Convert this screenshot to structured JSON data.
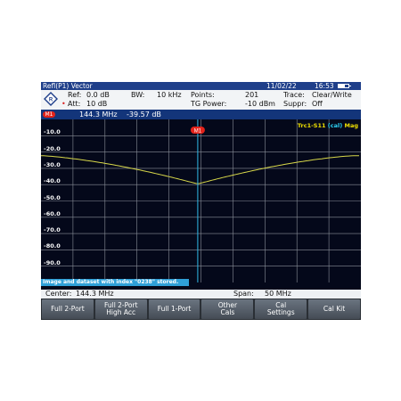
{
  "titlebar": {
    "title": "Refl(P1) Vector",
    "date": "11/02/22",
    "time": "16:53"
  },
  "params": {
    "ref_label": "Ref:",
    "ref_value": "0.0 dB",
    "att_label": "Att:",
    "att_value": "10 dB",
    "bw_label": "BW:",
    "bw_value": "10 kHz",
    "points_label": "Points:",
    "points_value": "201",
    "tg_label": "TG Power:",
    "tg_value": "-10 dBm",
    "trace_label": "Trace:",
    "trace_value": "Clear/Write",
    "suppr_label": "Suppr:",
    "suppr_value": "Off"
  },
  "marker": {
    "name": "M1",
    "freq": "144.3 MHz",
    "level": "-39.57 dB"
  },
  "plot": {
    "trace_label": "Trc1-S11",
    "trace_cal": "(cal)",
    "trace_mode": "Mag",
    "y_ticks": [
      "-10.0",
      "-20.0",
      "-30.0",
      "-40.0",
      "-50.0",
      "-60.0",
      "-70.0",
      "-80.0",
      "-90.0"
    ],
    "trace_color": "#d8d84a",
    "marker_line_color": "#2fb8e6",
    "status_message": "Image and dataset with index \"0238\" stored."
  },
  "footer": {
    "center_label": "Center:",
    "center_value": "144.3 MHz",
    "span_label": "Span:",
    "span_value": "50 MHz"
  },
  "softkeys": [
    "Full 2-Port",
    "Full 2-Port\nHigh Acc",
    "Full 1-Port",
    "Other\nCals",
    "Cal\nSettings",
    "Cal Kit"
  ]
}
